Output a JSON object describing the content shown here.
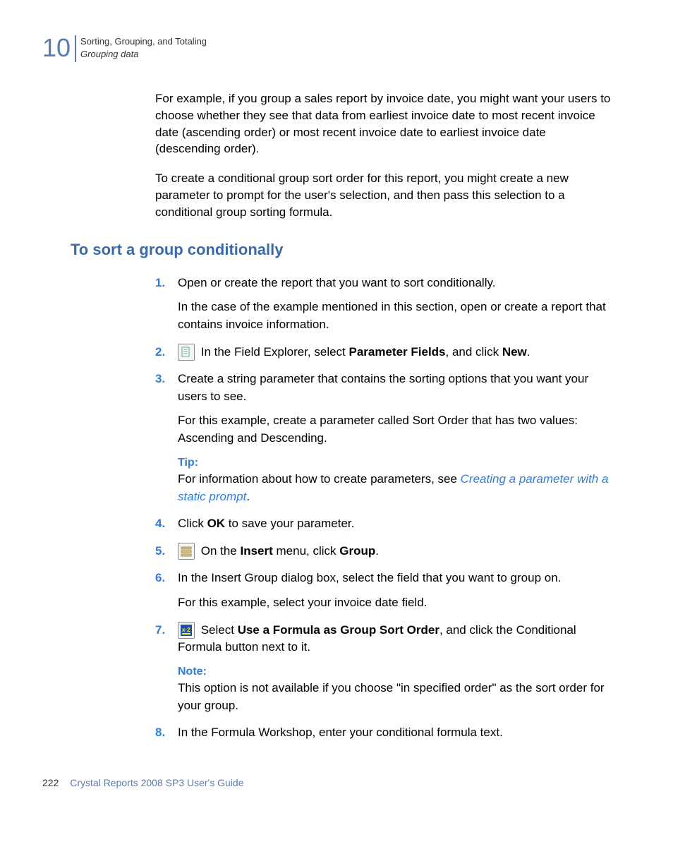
{
  "header": {
    "chapter_number": "10",
    "title": "Sorting, Grouping, and Totaling",
    "subtitle": "Grouping data"
  },
  "intro": {
    "p1": "For example, if you group a sales report by invoice date, you might want your users to choose whether they see that data from earliest invoice date to most recent invoice date (ascending order) or most recent invoice date to earliest invoice date (descending order).",
    "p2": "To create a conditional group sort order for this report, you might create a new parameter to prompt for the user's selection, and then pass this selection to a conditional group sorting formula."
  },
  "section_heading": "To sort a group conditionally",
  "steps": {
    "s1": {
      "num": "1.",
      "text": "Open or create the report that you want to sort conditionally.",
      "sub": "In the case of the example mentioned in this section, open or create a report that contains invoice information."
    },
    "s2": {
      "num": "2.",
      "pre": " In the Field Explorer, select ",
      "bold1": "Parameter Fields",
      "mid": ", and click ",
      "bold2": "New",
      "post": "."
    },
    "s3": {
      "num": "3.",
      "text": "Create a string parameter that contains the sorting options that you want your users to see.",
      "sub": "For this example, create a parameter called Sort Order that has two values: Ascending and Descending.",
      "tip_label": "Tip:",
      "tip_pre": "For information about how to create parameters, see ",
      "tip_link": "Creating a parameter with a static prompt",
      "tip_post": "."
    },
    "s4": {
      "num": "4.",
      "pre": "Click ",
      "bold1": "OK",
      "post": " to save your parameter."
    },
    "s5": {
      "num": "5.",
      "pre": " On the ",
      "bold1": "Insert",
      "mid": " menu, click ",
      "bold2": "Group",
      "post": "."
    },
    "s6": {
      "num": "6.",
      "text": "In the Insert Group dialog box, select the field that you want to group on.",
      "sub": "For this example, select your invoice date field."
    },
    "s7": {
      "num": "7.",
      "pre": " Select ",
      "bold1": "Use a Formula as Group Sort Order",
      "post": ", and click the Conditional Formula button next to it.",
      "note_label": "Note:",
      "note_text": "This option is not available if you choose \"in specified order\" as the sort order for your group."
    },
    "s8": {
      "num": "8.",
      "text": "In the Formula Workshop, enter your conditional formula text."
    }
  },
  "footer": {
    "page_number": "222",
    "doc_title": "Crystal Reports 2008 SP3 User's Guide"
  }
}
